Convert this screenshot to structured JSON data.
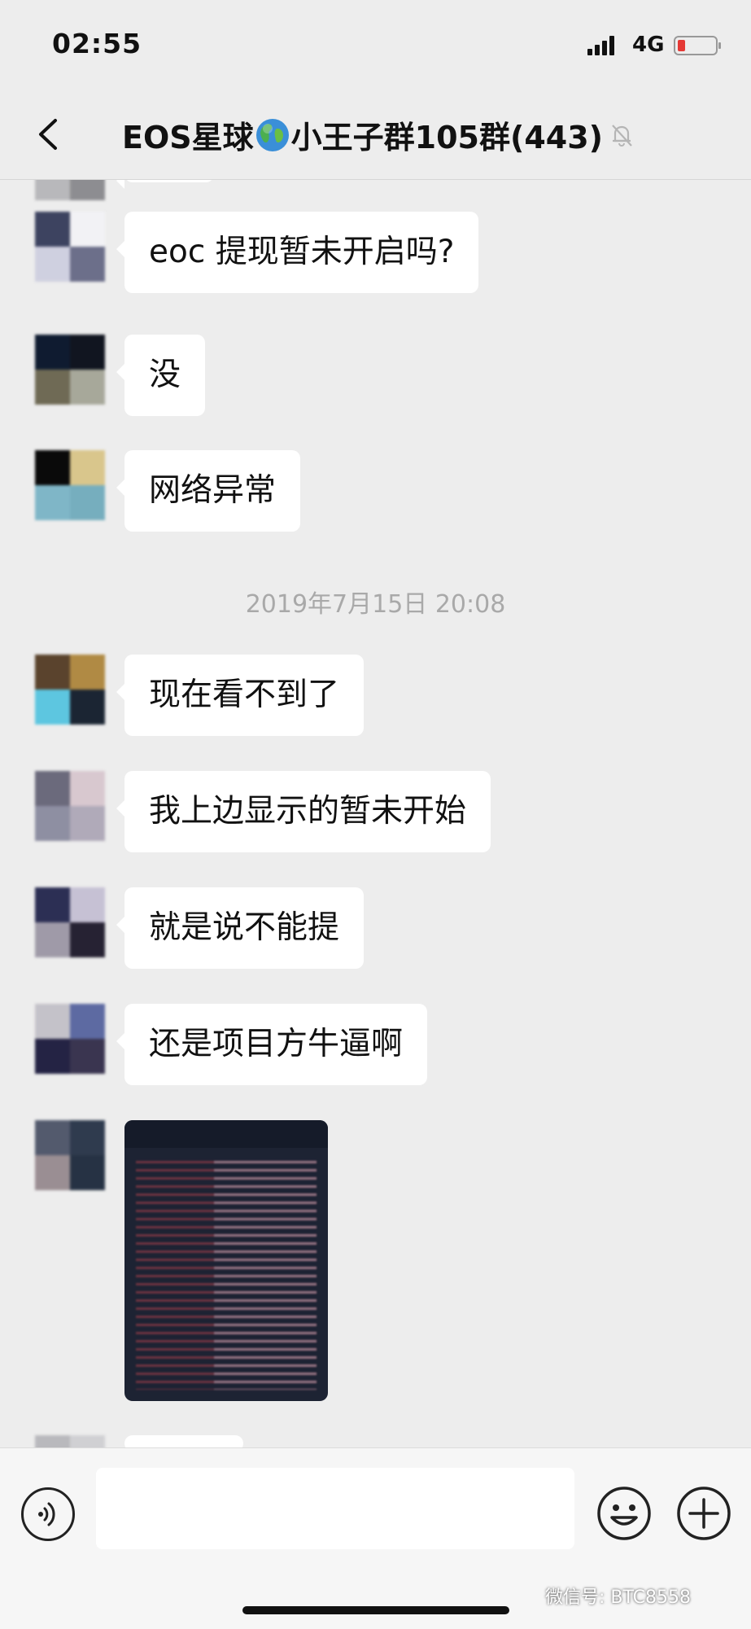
{
  "status_bar": {
    "time": "02:55",
    "network": "4G",
    "battery_color": "#e53935"
  },
  "header": {
    "title_before_icon": "EOS星球",
    "title_after_icon": "小王子群105群(443)",
    "title_icon": "globe-icon",
    "mute_icon": "bell-slash-icon"
  },
  "messages": [
    {
      "type": "text",
      "text": "eoc 提现暂未开启吗?",
      "avatar_colors": [
        "#3d4360",
        "#f2f2f5",
        "#cfd0e0",
        "#6c6f8a"
      ]
    },
    {
      "type": "text",
      "text": "没",
      "avatar_colors": [
        "#0f1b30",
        "#111520",
        "#6f6a55",
        "#a7a89a"
      ]
    },
    {
      "type": "text",
      "text": "网络异常",
      "avatar_colors": [
        "#0a0a0a",
        "#d9c68c",
        "#7fb6c7",
        "#76aebe"
      ]
    },
    {
      "type": "timestamp",
      "text": "2019年7月15日 20:08"
    },
    {
      "type": "text",
      "text": "现在看不到了",
      "avatar_colors": [
        "#5a432d",
        "#b08a44",
        "#5dc6e0",
        "#1b2533"
      ]
    },
    {
      "type": "text",
      "text": "我上边显示的暂未开始",
      "avatar_colors": [
        "#6b6a7c",
        "#d8c8cf",
        "#8e8fa2",
        "#b0aab9"
      ]
    },
    {
      "type": "text",
      "text": "就是说不能提",
      "avatar_colors": [
        "#2c2f54",
        "#c6c1d4",
        "#9f9aa8",
        "#262233"
      ]
    },
    {
      "type": "text",
      "text": "还是项目方牛逼啊",
      "avatar_colors": [
        "#c4c2c9",
        "#5d6aa2",
        "#242344",
        "#3a3550"
      ]
    },
    {
      "type": "image",
      "avatar_colors": [
        "#535a6d",
        "#2f3b4e",
        "#9a8e93",
        "#263244"
      ]
    }
  ],
  "input_bar": {
    "placeholder": "",
    "voice_icon": "voice-icon",
    "emoji_icon": "emoji-icon",
    "plus_icon": "plus-circle-icon"
  },
  "watermark": "微信号: BTC8558"
}
